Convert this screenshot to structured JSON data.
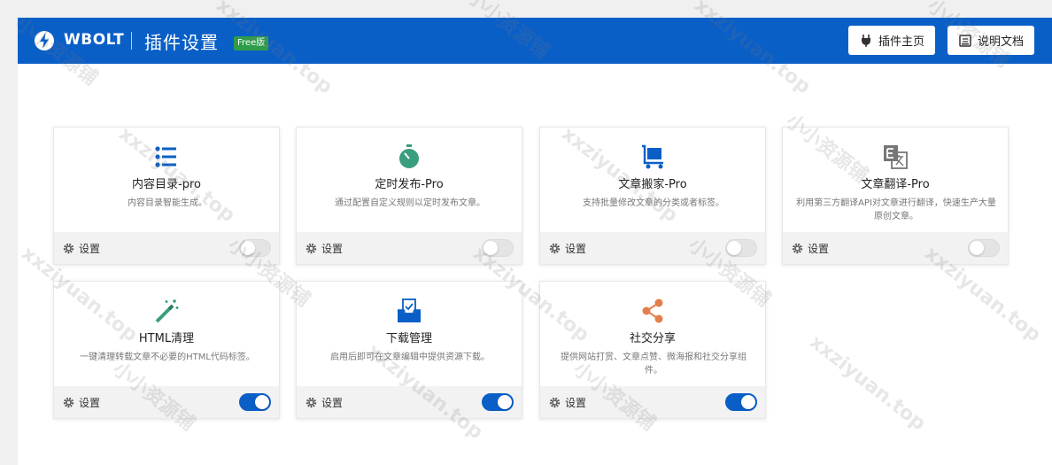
{
  "header": {
    "brand": "WBOLT",
    "page_title": "插件设置",
    "badge": "Free版",
    "btn_plugin_home": "插件主页",
    "btn_docs": "说明文档"
  },
  "colors": {
    "header_bg": "#0a5fc7",
    "badge_bg": "#2f9c4a",
    "toggle_on": "#0a5fc7",
    "icon_blue": "#0a5fc7",
    "icon_green": "#3a9e7e",
    "icon_orange": "#e47f4d"
  },
  "cards": [
    {
      "title": "内容目录-pro",
      "desc": "内容目录智能生成。",
      "icon": "list-icon",
      "settings": "设置",
      "enabled": false
    },
    {
      "title": "定时发布-Pro",
      "desc": "通过配置自定义规则以定时发布文章。",
      "icon": "timer-icon",
      "settings": "设置",
      "enabled": false
    },
    {
      "title": "文章搬家-Pro",
      "desc": "支持批量修改文章的分类或者标签。",
      "icon": "cart-icon",
      "settings": "设置",
      "enabled": false
    },
    {
      "title": "文章翻译-Pro",
      "desc": "利用第三方翻译API对文章进行翻译，快速生产大量原创文章。",
      "icon": "translate-icon",
      "settings": "设置",
      "enabled": false
    },
    {
      "title": "HTML清理",
      "desc": "一键清理转载文章不必要的HTML代码标签。",
      "icon": "magic-wand-icon",
      "settings": "设置",
      "enabled": true
    },
    {
      "title": "下载管理",
      "desc": "启用后即可在文章编辑中提供资源下载。",
      "icon": "download-tray-icon",
      "settings": "设置",
      "enabled": true
    },
    {
      "title": "社交分享",
      "desc": "提供网站打赏、文章点赞、微海报和社交分享组件。",
      "icon": "share-icon",
      "settings": "设置",
      "enabled": true
    }
  ],
  "watermarks": [
    "xxziyuan.top",
    "小小资源铺"
  ]
}
